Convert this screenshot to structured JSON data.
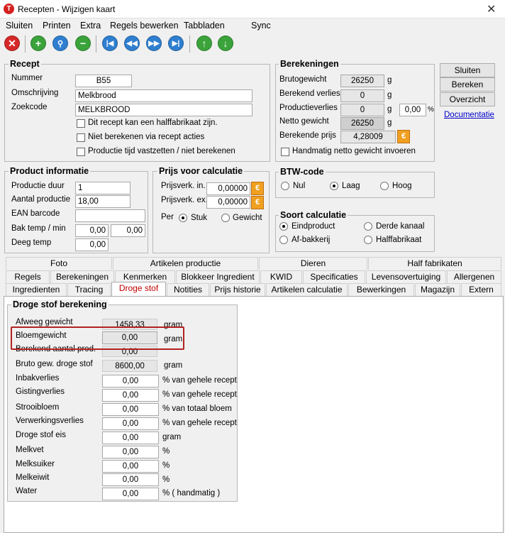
{
  "window": {
    "title": "Recepten - Wijzigen kaart",
    "close": "✕"
  },
  "menu": [
    {
      "label": "Sluiten"
    },
    {
      "label": "Printen"
    },
    {
      "label": "Extra"
    },
    {
      "label": "Regels bewerken"
    },
    {
      "label": "Tabbladen"
    },
    {
      "label": "Sync"
    }
  ],
  "toolbar": {
    "icons": [
      "close-icon",
      "add-icon",
      "search-icon",
      "remove-icon",
      "first-icon",
      "previous-icon",
      "next-icon",
      "last-icon",
      "up-icon",
      "down-icon"
    ]
  },
  "recept": {
    "title": "Recept",
    "nummer_label": "Nummer",
    "nummer": "B55",
    "omschrijving_label": "Omschrijving",
    "omschrijving": "Melkbrood",
    "zoekcode_label": "Zoekcode",
    "zoekcode": "MELKBROOD",
    "chk1": "Dit recept kan een halffabrikaat zijn.",
    "chk2": "Niet berekenen via recept acties",
    "chk3": "Productie tijd vastzetten / niet berekenen"
  },
  "berekeningen": {
    "title": "Berekeningen",
    "bruto_label": "Brutogewicht",
    "bruto": "26250",
    "verlies_label": "Berekend verlies",
    "verlies": "0",
    "prodverlies_label": "Productieverlies",
    "prodverlies": "0",
    "prodverlies_pct": "0,00",
    "netto_label": "Netto gewicht",
    "netto": "26250",
    "prijs_label": "Berekende prijs",
    "prijs": "4,28009",
    "unit_g": "g",
    "unit_pct": "%",
    "handmatig": "Handmatig netto gewicht invoeren"
  },
  "side_buttons": {
    "sluiten": "Sluiten",
    "bereken": "Bereken",
    "overzicht": "Overzicht",
    "documentatie": "Documentatie"
  },
  "product": {
    "title": "Product informatie",
    "duur_label": "Productie duur",
    "duur": "1",
    "aantal_label": "Aantal productie",
    "aantal": "18,00",
    "ean_label": "EAN barcode",
    "ean": "",
    "bak_label": "Bak temp / min",
    "bak1": "0,00",
    "bak2": "0,00",
    "deeg_label": "Deeg temp",
    "deeg": "0,00"
  },
  "prijs": {
    "title": "Prijs voor calculatie",
    "in_label": "Prijsverk. in.",
    "in": "0,00000",
    "ex_label": "Prijsverk. ex.",
    "ex": "0,00000",
    "per_label": "Per",
    "stuk": "Stuk",
    "gewicht": "Gewicht"
  },
  "btw": {
    "title": "BTW-code",
    "nul": "Nul",
    "laag": "Laag",
    "hoog": "Hoog"
  },
  "soort": {
    "title": "Soort calculatie",
    "eind": "Eindproduct",
    "derde": "Derde kanaal",
    "af": "Af-bakkerij",
    "half": "Halffabrikaat"
  },
  "tabs": {
    "row1": [
      "Foto",
      "Artikelen productie",
      "Dieren",
      "Half fabrikaten"
    ],
    "row2": [
      "Regels",
      "Berekeningen",
      "Kenmerken",
      "Blokkeer Ingredient",
      "KWID",
      "Specificaties",
      "Levensovertuiging",
      "Allergenen"
    ],
    "row3": [
      "Ingredienten",
      "Tracing",
      "Droge stof",
      "Notities",
      "Prijs historie",
      "Artikelen calculatie",
      "Bewerkingen",
      "Magazijn",
      "Extern"
    ]
  },
  "droge": {
    "title": "Droge stof berekening",
    "rows": [
      {
        "label": "Afweeg gewicht",
        "value": "1458,33",
        "unit": "gram"
      },
      {
        "label": "Bloemgewicht",
        "value": "0,00",
        "unit": "gram"
      },
      {
        "label": "Berekend aantal prod.",
        "value": "0,00",
        "unit": ""
      },
      {
        "label": "Bruto gew. droge stof",
        "value": "8600,00",
        "unit": "gram"
      },
      {
        "label": "Inbakverlies",
        "value": "0,00",
        "unit": "% van gehele recept"
      },
      {
        "label": "Gistingverlies",
        "value": "0,00",
        "unit": "% van gehele recept"
      },
      {
        "label": "Strooibloem",
        "value": "0,00",
        "unit": "% van totaal bloem"
      },
      {
        "label": "Verwerkingsverlies",
        "value": "0,00",
        "unit": "% van gehele recept"
      },
      {
        "label": "Droge stof eis",
        "value": "0,00",
        "unit": "gram"
      },
      {
        "label": "Melkvet",
        "value": "0,00",
        "unit": "%"
      },
      {
        "label": "Melksuiker",
        "value": "0,00",
        "unit": "%"
      },
      {
        "label": "Melkeiwit",
        "value": "0,00",
        "unit": "%"
      },
      {
        "label": "Water",
        "value": "0,00",
        "unit": "% ( handmatig )"
      }
    ]
  },
  "colors": {
    "highlight": "#b22222",
    "active_tab": "#c00000",
    "link": "#0000cc"
  }
}
